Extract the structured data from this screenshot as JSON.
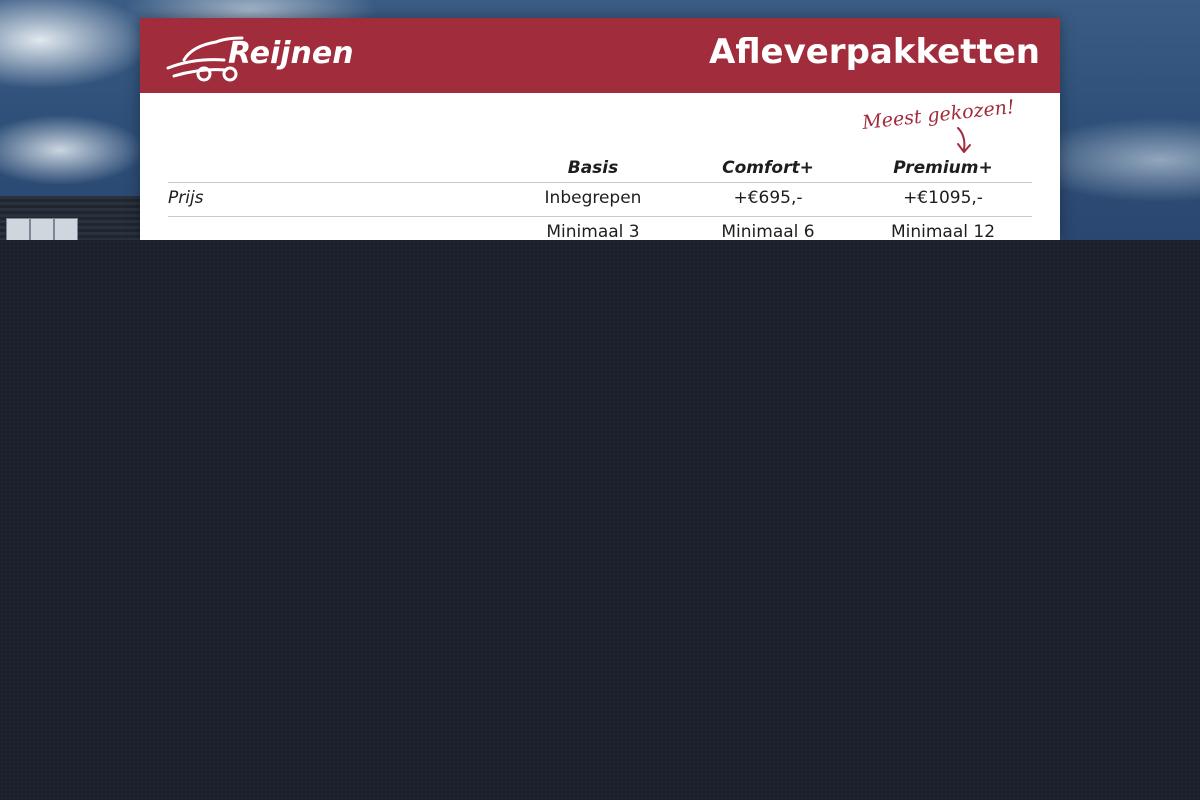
{
  "brand": {
    "logo_text": "Reijnen",
    "accent_color": "#a12c3c"
  },
  "document": {
    "title": "Afleverpakketten",
    "annotation": "Meest gekozen!",
    "columns": [
      "Basis",
      "Comfort+",
      "Premium+"
    ],
    "rows": [
      {
        "label": "Prijs",
        "values": [
          "Inbegrepen",
          "+€695,-",
          "+€1095,-"
        ]
      },
      {
        "label": "",
        "values": [
          "Minimaal 3",
          "Minimaal 6",
          "Minimaal 12"
        ]
      }
    ]
  },
  "icons": {
    "logo": "car-logo-icon",
    "arrow": "down-arrow-icon"
  }
}
